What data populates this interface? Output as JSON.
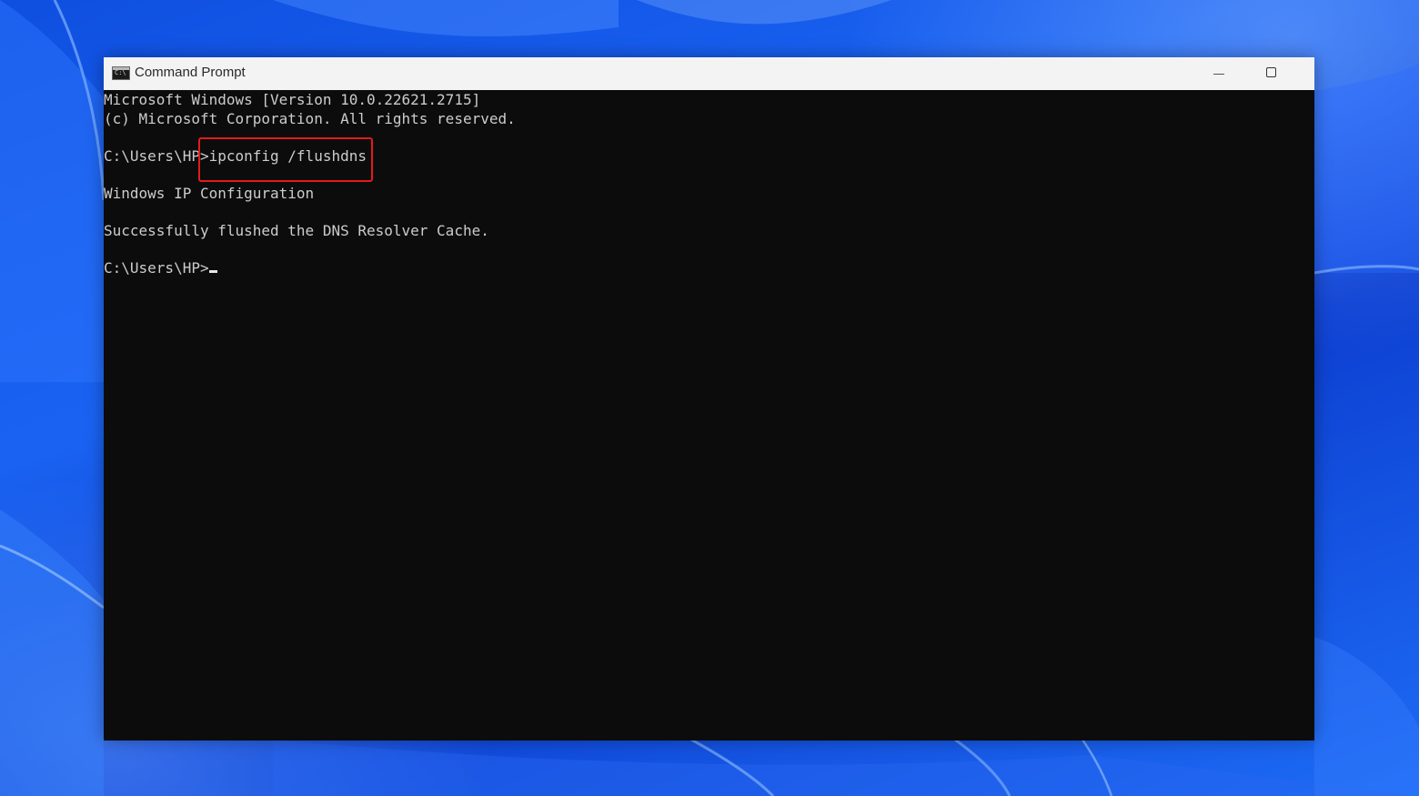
{
  "window": {
    "title": "Command Prompt",
    "icon": "cmd-app-icon",
    "controls": {
      "minimize": "minimize-icon",
      "maximize": "maximize-icon"
    }
  },
  "console": {
    "lines": [
      "Microsoft Windows [Version 10.0.22621.2715]",
      "(c) Microsoft Corporation. All rights reserved.",
      "",
      "",
      "",
      "Windows IP Configuration",
      "",
      "Successfully flushed the DNS Resolver Cache.",
      ""
    ],
    "command_prompt": "C:\\Users\\HP>",
    "command": "ipconfig /flushdns",
    "current_prompt": "C:\\Users\\HP>"
  },
  "colors": {
    "console_background": "#0c0c0c",
    "console_text": "#cccccc",
    "highlight_box": "#e31b1b",
    "desktop": "#1a63f2"
  }
}
